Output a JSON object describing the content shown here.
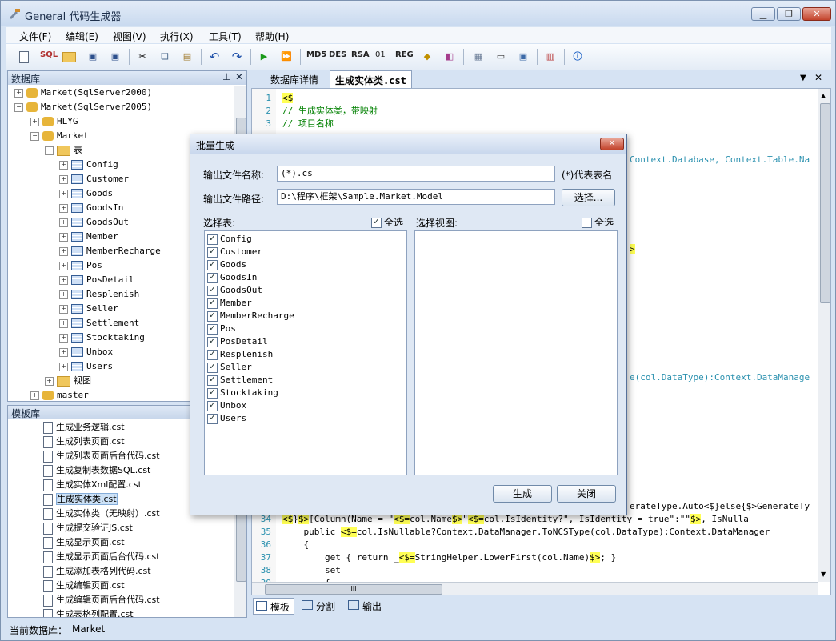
{
  "app": {
    "title": "General 代码生成器"
  },
  "menu": [
    "文件(F)",
    "编辑(E)",
    "视图(V)",
    "执行(X)",
    "工具(T)",
    "帮助(H)"
  ],
  "toolbar": {
    "sql": "SQL",
    "md5": "MD5",
    "des": "DES",
    "rsa": "RSA",
    "o1": "01",
    "reg": "REG"
  },
  "db_panel": {
    "title": "数据库",
    "servers": [
      "Market(SqlServer2000)",
      "Market(SqlServer2005)"
    ],
    "databases": [
      "HLYG",
      "Market",
      "master"
    ],
    "tables_folder": "表",
    "views_folder": "视图",
    "tables": [
      "Config",
      "Customer",
      "Goods",
      "GoodsIn",
      "GoodsOut",
      "Member",
      "MemberRecharge",
      "Pos",
      "PosDetail",
      "Resplenish",
      "Seller",
      "Settlement",
      "Stocktaking",
      "Unbox",
      "Users"
    ]
  },
  "template_panel": {
    "title": "模板库",
    "files": [
      "生成业务逻辑.cst",
      "生成列表页面.cst",
      "生成列表页面后台代码.cst",
      "生成复制表数据SQL.cst",
      "生成实体Xml配置.cst",
      "生成实体类.cst",
      "生成实体类（无映射）.cst",
      "生成提交验证JS.cst",
      "生成显示页面.cst",
      "生成显示页面后台代码.cst",
      "生成添加表格列代码.cst",
      "生成编辑页面.cst",
      "生成编辑页面后台代码.cst",
      "生成表格列配置.cst"
    ],
    "selected": "生成实体类.cst"
  },
  "editor": {
    "tabs": [
      "数据库详情",
      "生成实体类.cst"
    ],
    "active_tab": "生成实体类.cst",
    "top_lines": [
      {
        "n": "1",
        "text": "<$"
      },
      {
        "n": "2",
        "text": "// 生成实体类，带映射"
      },
      {
        "n": "3",
        "text": "// 项目名称"
      }
    ],
    "right_fragments": {
      "context": "Context.Database, Context.Table.Na",
      "close_tag": ">",
      "datatype": "e(col.DataType):Context.DataManage",
      "line33": "erateType.Auto<$}else{$>GenerateTy"
    },
    "bottom_lines": [
      {
        "n": "34",
        "text": "<$}$>[Column(Name = \"<$=col.Name$>\"<$=col.IsIdentity?\", IsIdentity = true\":\"\"$>, IsNulla"
      },
      {
        "n": "35",
        "text": "    public <$=col.IsNullable?Context.DataManager.ToNCSType(col.DataType):Context.DataManager"
      },
      {
        "n": "36",
        "text": "    {"
      },
      {
        "n": "37",
        "text": "        get { return _<$=StringHelper.LowerFirst(col.Name)$>; }"
      },
      {
        "n": "38",
        "text": "        set"
      },
      {
        "n": "39",
        "text": "        {"
      }
    ],
    "bottom_tabs": [
      "模板",
      "分割",
      "输出"
    ],
    "hscroll_mark": "III"
  },
  "status": {
    "label": "当前数据库：",
    "value": "Market"
  },
  "dialog": {
    "title": "批量生成",
    "file_name_label": "输出文件名称:",
    "file_name_value": "(*).cs",
    "file_name_hint": "(*)代表表名",
    "path_label": "输出文件路径:",
    "path_value": "D:\\程序\\框架\\Sample.Market.Model",
    "browse_button": "选择...",
    "select_tables_label": "选择表:",
    "select_all_tables": "全选",
    "select_all_tables_checked": true,
    "select_views_label": "选择视图:",
    "select_all_views": "全选",
    "select_all_views_checked": false,
    "tables": [
      "Config",
      "Customer",
      "Goods",
      "GoodsIn",
      "GoodsOut",
      "Member",
      "MemberRecharge",
      "Pos",
      "PosDetail",
      "Resplenish",
      "Seller",
      "Settlement",
      "Stocktaking",
      "Unbox",
      "Users"
    ],
    "generate_button": "生成",
    "close_button": "关闭"
  }
}
